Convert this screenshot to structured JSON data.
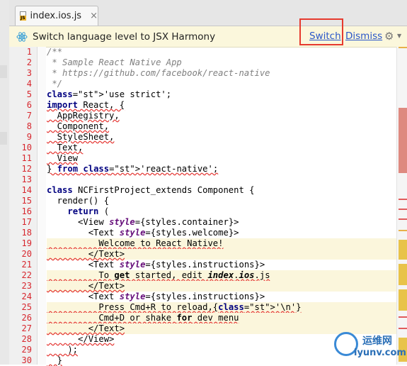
{
  "tab": {
    "label": "index.ios.js",
    "close": "×"
  },
  "notification": {
    "message": "Switch language level to JSX Harmony",
    "switch_label": "Switch",
    "dismiss_label": "Dismiss",
    "gear_icon": "gear-icon"
  },
  "line_numbers": [
    "1",
    "2",
    "3",
    "4",
    "5",
    "6",
    "7",
    "8",
    "9",
    "10",
    "11",
    "12",
    "13",
    "14",
    "15",
    "16",
    "17",
    "18",
    "19",
    "20",
    "21",
    "22",
    "23",
    "24",
    "25",
    "26",
    "27",
    "28",
    "29",
    "30"
  ],
  "code": [
    "/**",
    " * Sample React Native App",
    " * https://github.com/facebook/react-native",
    " */",
    "'use strict';",
    "import React, {",
    "  AppRegistry,",
    "  Component,",
    "  StyleSheet,",
    "  Text,",
    "  View",
    "} from 'react-native';",
    "",
    "class NCFirstProject_extends Component {",
    "  render() {",
    "    return (",
    "      <View style={styles.container}>",
    "        <Text style={styles.welcome}>",
    "          Welcome to React Native!",
    "        </Text>",
    "        <Text style={styles.instructions}>",
    "          To get started, edit index.ios.js",
    "        </Text>",
    "        <Text style={styles.instructions}>",
    "          Press Cmd+R to reload,{'\\n'}",
    "          Cmd+D or shake for dev menu",
    "        </Text>",
    "      </View>",
    "    );",
    "  }"
  ],
  "watermark": {
    "cn": "运维网",
    "en": "iyunv.com"
  },
  "colors": {
    "accent_link": "#2a57c9",
    "highlight_box": "#e63a2e",
    "notification_bg": "#fbf7dc",
    "line_number": "#d7262d"
  }
}
